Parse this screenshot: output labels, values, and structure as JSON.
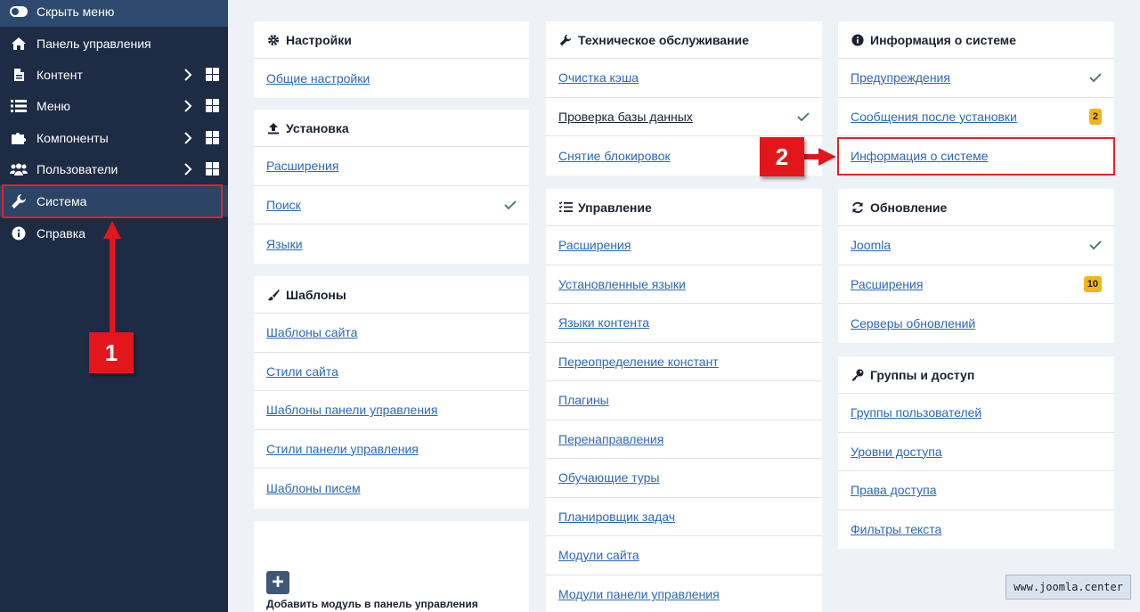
{
  "sidebar": {
    "toggle_label": "Скрыть меню",
    "items": [
      {
        "label": "Панель управления"
      },
      {
        "label": "Контент"
      },
      {
        "label": "Меню"
      },
      {
        "label": "Компоненты"
      },
      {
        "label": "Пользователи"
      },
      {
        "label": "Система"
      },
      {
        "label": "Справка"
      }
    ]
  },
  "cards": {
    "settings": {
      "title": "Настройки",
      "rows": [
        "Общие настройки"
      ]
    },
    "install": {
      "title": "Установка",
      "rows": [
        "Расширения",
        "Поиск",
        "Языки"
      ]
    },
    "templates": {
      "title": "Шаблоны",
      "rows": [
        "Шаблоны сайта",
        "Стили сайта",
        "Шаблоны панели управления",
        "Стили панели управления",
        "Шаблоны писем"
      ]
    },
    "add_module": {
      "label": "Добавить модуль в панель управления"
    },
    "maintenance": {
      "title": "Техническое обслуживание",
      "rows": [
        "Очистка кэша",
        "Проверка базы данных",
        "Снятие блокировок"
      ]
    },
    "manage": {
      "title": "Управление",
      "rows": [
        "Расширения",
        "Установленные языки",
        "Языки контента",
        "Переопределение констант",
        "Плагины",
        "Перенаправления",
        "Обучающие туры",
        "Планировщик задач",
        "Модули сайта",
        "Модули панели управления"
      ]
    },
    "sysinfo": {
      "title": "Информация о системе",
      "rows": [
        "Предупреждения",
        "Сообщения после установки",
        "Информация о системе"
      ],
      "badge": "2"
    },
    "update": {
      "title": "Обновление",
      "rows": [
        "Joomla",
        "Расширения",
        "Серверы обновлений"
      ],
      "badge": "10"
    },
    "access": {
      "title": "Группы и доступ",
      "rows": [
        "Группы пользователей",
        "Уровни доступа",
        "Права доступа",
        "Фильтры текста"
      ]
    }
  },
  "annotations": {
    "step1": "1",
    "step2": "2"
  },
  "watermark": "www.joomla.center",
  "colors": {
    "sidebar": "#1d2c44",
    "link": "#2a69b8",
    "badge": "#f3b41c",
    "annotation": "#e0222a",
    "check": "#3d7a4d"
  }
}
